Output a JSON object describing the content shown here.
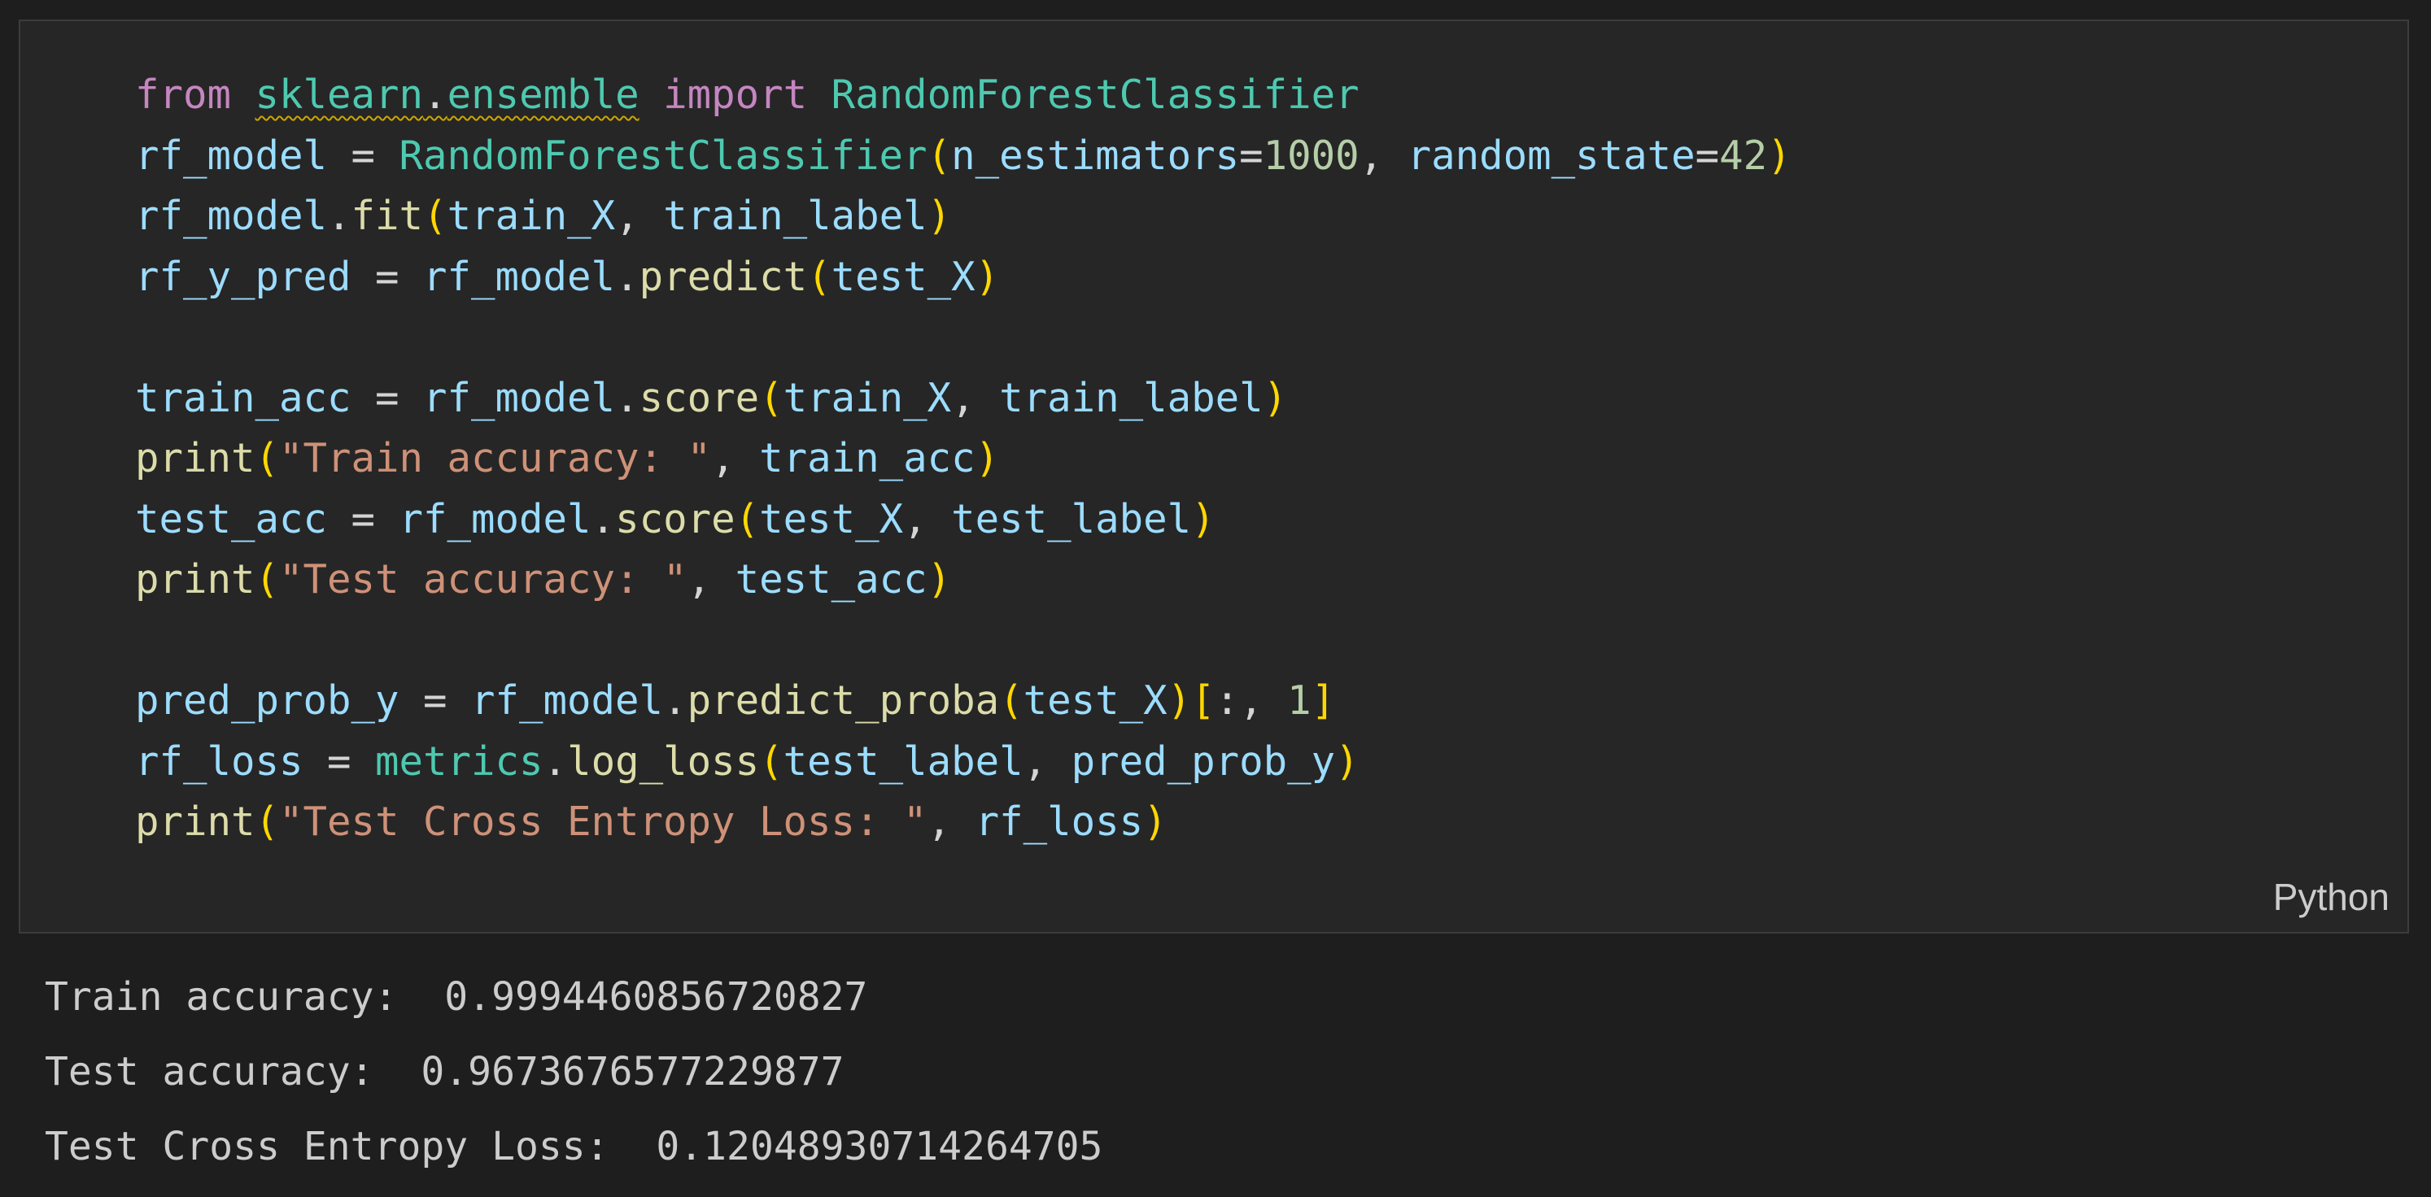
{
  "cell": {
    "language_label": "Python",
    "code_lines": [
      [
        {
          "t": "from",
          "c": "kw"
        },
        {
          "t": " ",
          "c": "op"
        },
        {
          "t": "sklearn",
          "c": "cls",
          "squiggle": true
        },
        {
          "t": ".",
          "c": "op",
          "squiggle": true
        },
        {
          "t": "ensemble",
          "c": "cls",
          "squiggle": true
        },
        {
          "t": " ",
          "c": "op"
        },
        {
          "t": "import",
          "c": "kw"
        },
        {
          "t": " ",
          "c": "op"
        },
        {
          "t": "RandomForestClassifier",
          "c": "cls"
        }
      ],
      [
        {
          "t": "rf_model",
          "c": "var"
        },
        {
          "t": " = ",
          "c": "op"
        },
        {
          "t": "RandomForestClassifier",
          "c": "cls"
        },
        {
          "t": "(",
          "c": "paren"
        },
        {
          "t": "n_estimators",
          "c": "var"
        },
        {
          "t": "=",
          "c": "op"
        },
        {
          "t": "1000",
          "c": "num"
        },
        {
          "t": ", ",
          "c": "op"
        },
        {
          "t": "random_state",
          "c": "var"
        },
        {
          "t": "=",
          "c": "op"
        },
        {
          "t": "42",
          "c": "num"
        },
        {
          "t": ")",
          "c": "paren"
        }
      ],
      [
        {
          "t": "rf_model",
          "c": "var"
        },
        {
          "t": ".",
          "c": "op"
        },
        {
          "t": "fit",
          "c": "fn"
        },
        {
          "t": "(",
          "c": "paren"
        },
        {
          "t": "train_X",
          "c": "var"
        },
        {
          "t": ", ",
          "c": "op"
        },
        {
          "t": "train_label",
          "c": "var"
        },
        {
          "t": ")",
          "c": "paren"
        }
      ],
      [
        {
          "t": "rf_y_pred",
          "c": "var"
        },
        {
          "t": " = ",
          "c": "op"
        },
        {
          "t": "rf_model",
          "c": "var"
        },
        {
          "t": ".",
          "c": "op"
        },
        {
          "t": "predict",
          "c": "fn"
        },
        {
          "t": "(",
          "c": "paren"
        },
        {
          "t": "test_X",
          "c": "var"
        },
        {
          "t": ")",
          "c": "paren"
        }
      ],
      [],
      [
        {
          "t": "train_acc",
          "c": "var"
        },
        {
          "t": " = ",
          "c": "op"
        },
        {
          "t": "rf_model",
          "c": "var"
        },
        {
          "t": ".",
          "c": "op"
        },
        {
          "t": "score",
          "c": "fn"
        },
        {
          "t": "(",
          "c": "paren"
        },
        {
          "t": "train_X",
          "c": "var"
        },
        {
          "t": ", ",
          "c": "op"
        },
        {
          "t": "train_label",
          "c": "var"
        },
        {
          "t": ")",
          "c": "paren"
        }
      ],
      [
        {
          "t": "print",
          "c": "fn"
        },
        {
          "t": "(",
          "c": "paren"
        },
        {
          "t": "\"Train accuracy: \"",
          "c": "str"
        },
        {
          "t": ", ",
          "c": "op"
        },
        {
          "t": "train_acc",
          "c": "var"
        },
        {
          "t": ")",
          "c": "paren"
        }
      ],
      [
        {
          "t": "test_acc",
          "c": "var"
        },
        {
          "t": " = ",
          "c": "op"
        },
        {
          "t": "rf_model",
          "c": "var"
        },
        {
          "t": ".",
          "c": "op"
        },
        {
          "t": "score",
          "c": "fn"
        },
        {
          "t": "(",
          "c": "paren"
        },
        {
          "t": "test_X",
          "c": "var"
        },
        {
          "t": ", ",
          "c": "op"
        },
        {
          "t": "test_label",
          "c": "var"
        },
        {
          "t": ")",
          "c": "paren"
        }
      ],
      [
        {
          "t": "print",
          "c": "fn"
        },
        {
          "t": "(",
          "c": "paren"
        },
        {
          "t": "\"Test accuracy: \"",
          "c": "str"
        },
        {
          "t": ", ",
          "c": "op"
        },
        {
          "t": "test_acc",
          "c": "var"
        },
        {
          "t": ")",
          "c": "paren"
        }
      ],
      [],
      [
        {
          "t": "pred_prob_y",
          "c": "var"
        },
        {
          "t": " = ",
          "c": "op"
        },
        {
          "t": "rf_model",
          "c": "var"
        },
        {
          "t": ".",
          "c": "op"
        },
        {
          "t": "predict_proba",
          "c": "fn"
        },
        {
          "t": "(",
          "c": "paren"
        },
        {
          "t": "test_X",
          "c": "var"
        },
        {
          "t": ")",
          "c": "paren"
        },
        {
          "t": "[",
          "c": "paren"
        },
        {
          "t": ":, ",
          "c": "op"
        },
        {
          "t": "1",
          "c": "num"
        },
        {
          "t": "]",
          "c": "paren"
        }
      ],
      [
        {
          "t": "rf_loss",
          "c": "var"
        },
        {
          "t": " = ",
          "c": "op"
        },
        {
          "t": "metrics",
          "c": "cls"
        },
        {
          "t": ".",
          "c": "op"
        },
        {
          "t": "log_loss",
          "c": "fn"
        },
        {
          "t": "(",
          "c": "paren"
        },
        {
          "t": "test_label",
          "c": "var"
        },
        {
          "t": ", ",
          "c": "op"
        },
        {
          "t": "pred_prob_y",
          "c": "var"
        },
        {
          "t": ")",
          "c": "paren"
        }
      ],
      [
        {
          "t": "print",
          "c": "fn"
        },
        {
          "t": "(",
          "c": "paren"
        },
        {
          "t": "\"Test Cross Entropy Loss: \"",
          "c": "str"
        },
        {
          "t": ", ",
          "c": "op"
        },
        {
          "t": "rf_loss",
          "c": "var"
        },
        {
          "t": ")",
          "c": "paren"
        }
      ]
    ]
  },
  "output": {
    "lines": [
      "Train accuracy:  0.9994460856720827",
      "Test accuracy:  0.9673676577229877",
      "Test Cross Entropy Loss:  0.12048930714264705"
    ]
  },
  "colors": {
    "background": "#1e1e1e",
    "cell_background": "#262626",
    "keyword": "#c586c0",
    "class": "#4ec9b0",
    "variable": "#9cdcfe",
    "function": "#dcdcaa",
    "number": "#b5cea8",
    "string": "#ce9178",
    "bracket": "#ffd700"
  }
}
